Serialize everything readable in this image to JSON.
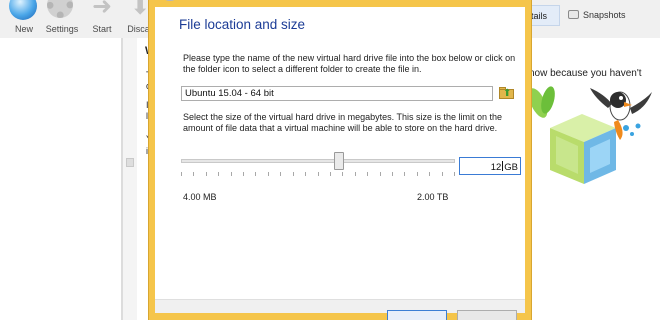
{
  "toolbar": {
    "new_label": "New",
    "settings_label": "Settings",
    "start_label": "Start",
    "discard_label": "Discar"
  },
  "tabs": {
    "details_label": "etails",
    "snapshots_label": "Snapshots"
  },
  "welcome": {
    "heading": "W",
    "frag_1": "T",
    "frag_2": "c",
    "frag_3": "I",
    "frag_4": "l",
    "frag_5": "Y",
    "frag_6": "i",
    "right_text": "now because you haven't"
  },
  "dialog": {
    "title": "File location and size",
    "description_location": "Please type the name of the new virtual hard drive file into the box below or click on the folder icon to select a different folder to create the file in.",
    "file_name": "Ubuntu 15.04 - 64 bit",
    "description_size": "Select the size of the virtual hard drive in megabytes. This size is the limit on the amount of file data that a virtual machine will be able to store on the hard drive.",
    "size_value": "12",
    "size_unit": "GB",
    "slider_fraction": 0.58,
    "slider_min_label": "4.00 MB",
    "slider_max_label": "2.00 TB"
  },
  "colors": {
    "title_blue": "#1c3c96",
    "dialog_frame": "#f5c54a",
    "focus_border": "#3a7bd5"
  },
  "icons": {
    "new": "new-icon",
    "settings": "gear-icon",
    "start": "start-arrow-icon",
    "discard": "discard-arrow-icon",
    "folder": "folder-open-icon",
    "snapshots": "camera-icon",
    "mascot": "virtualbox-mascot-icon"
  }
}
